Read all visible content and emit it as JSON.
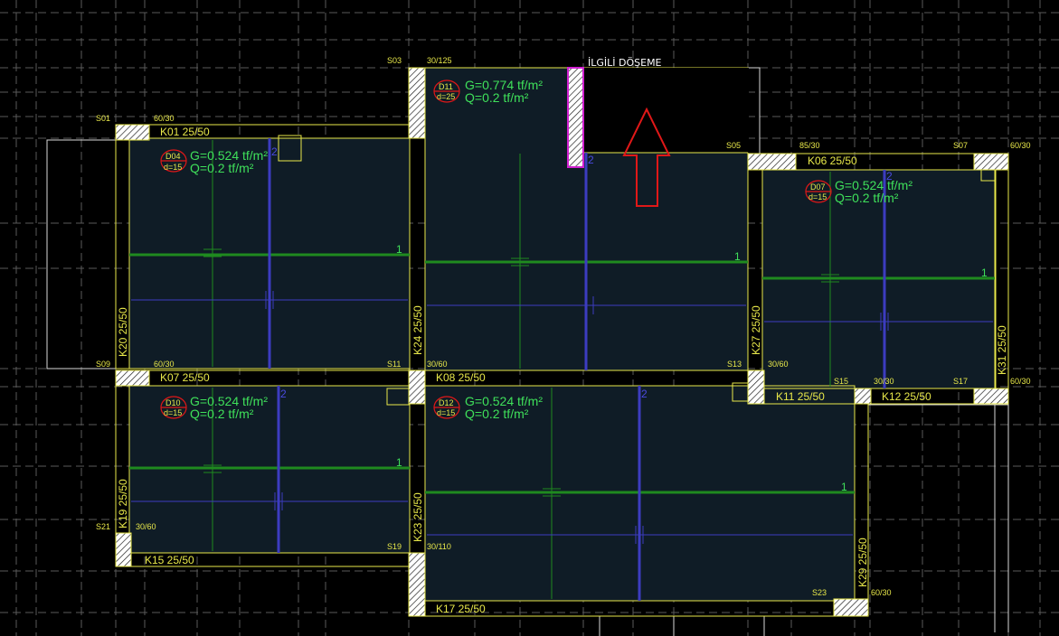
{
  "callout": {
    "text": "İLGİLİ DÖŞEME"
  },
  "columns": {
    "S01": "S01",
    "S03": "S03",
    "S05": "S05",
    "S07": "S07",
    "S09": "S09",
    "S11": "S11",
    "S13": "S13",
    "S15": "S15",
    "S17": "S17",
    "S19": "S19",
    "S21": "S21",
    "S23": "S23"
  },
  "col_dims": {
    "d_60_30_a": "60/30",
    "d_30_125": "30/125",
    "d_85_30": "85/30",
    "d_60_30_b": "60/30",
    "d_60_30_c": "60/30",
    "d_30_60_a": "30/60",
    "d_30_60_b": "30/60",
    "d_30_30": "30/30",
    "d_60_30_d": "60/30",
    "d_30_60_c": "30/60",
    "d_30_110": "30/110",
    "d_60_30_e": "60/30",
    "d_30_60_d": "30/60"
  },
  "beams": {
    "K01": "K01 25/50",
    "K06": "K06 25/50",
    "K07": "K07 25/50",
    "K08": "K08 25/50",
    "K11": "K11 25/50",
    "K12": "K12 25/50",
    "K15": "K15 25/50",
    "K17": "K17 25/50",
    "K19": "K19 25/50",
    "K20": "K20 25/50",
    "K23": "K23 25/50",
    "K24": "K24 25/50",
    "K27": "K27 25/50",
    "K29": "K29 25/50",
    "K31": "K31 25/50"
  },
  "slabs": {
    "D04": {
      "id": "D04",
      "d": "d=15",
      "g": "G=0.524 tf/m²",
      "q": "Q=0.2 tf/m²"
    },
    "D11": {
      "id": "D11",
      "d": "d=25",
      "g": "G=0.774 tf/m²",
      "q": "Q=0.2 tf/m²"
    },
    "D07": {
      "id": "D07",
      "d": "d=15",
      "g": "G=0.524 tf/m²",
      "q": "Q=0.2 tf/m²"
    },
    "D10": {
      "id": "D10",
      "d": "d=15",
      "g": "G=0.524 tf/m²",
      "q": "Q=0.2 tf/m²"
    },
    "D12": {
      "id": "D12",
      "d": "d=15",
      "g": "G=0.524 tf/m²",
      "q": "Q=0.2 tf/m²"
    }
  },
  "axis_marks": {
    "one": "1",
    "two": "2"
  },
  "colors": {
    "background": "#000000",
    "slab_fill": "#0f1c26",
    "outline": "#e8e84a",
    "dir1": "#1f8a1f",
    "dir2": "#3c3cc0",
    "load_text": "#3fe05a",
    "marker": "#e01818",
    "selected_wall": "#d020d0"
  }
}
